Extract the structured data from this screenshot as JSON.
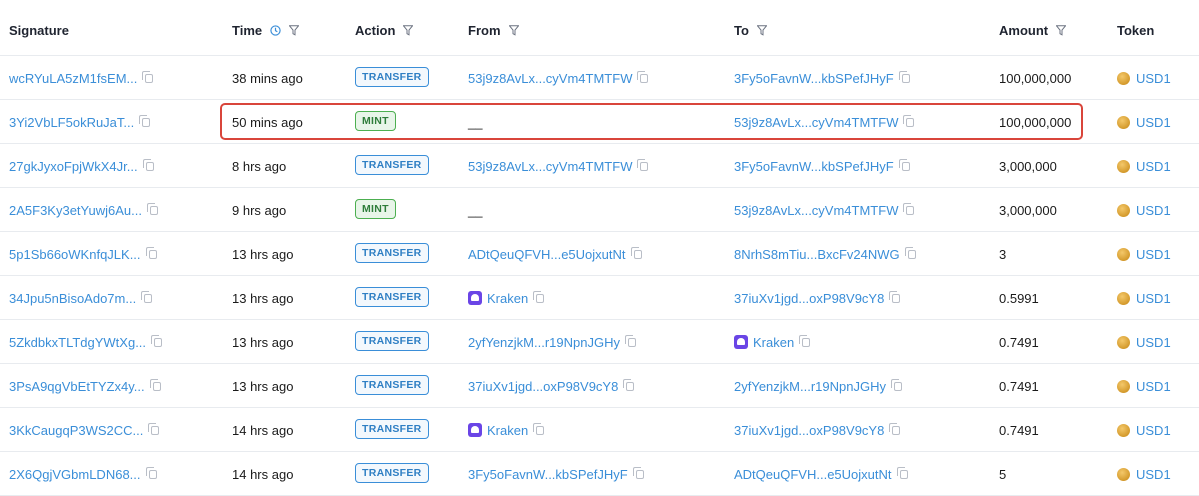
{
  "columns": {
    "signature": "Signature",
    "time": "Time",
    "action": "Action",
    "from": "From",
    "to": "To",
    "amount": "Amount",
    "token": "Token"
  },
  "rows": [
    {
      "signature": "wcRYuLA5zM1fsEM...",
      "time": "38 mins ago",
      "action": "TRANSFER",
      "from": "53j9z8AvLx...cyVm4TMTFW",
      "to": "3Fy5oFavnW...kbSPefJHyF",
      "amount": "100,000,000",
      "token": "USD1"
    },
    {
      "signature": "3Yi2VbLF5okRuJaT...",
      "time": "50 mins ago",
      "action": "MINT",
      "from": "__",
      "to": "53j9z8AvLx...cyVm4TMTFW",
      "amount": "100,000,000",
      "token": "USD1"
    },
    {
      "signature": "27gkJyxoFpjWkX4Jr...",
      "time": "8 hrs ago",
      "action": "TRANSFER",
      "from": "53j9z8AvLx...cyVm4TMTFW",
      "to": "3Fy5oFavnW...kbSPefJHyF",
      "amount": "3,000,000",
      "token": "USD1"
    },
    {
      "signature": "2A5F3Ky3etYuwj6Au...",
      "time": "9 hrs ago",
      "action": "MINT",
      "from": "__",
      "to": "53j9z8AvLx...cyVm4TMTFW",
      "amount": "3,000,000",
      "token": "USD1"
    },
    {
      "signature": "5p1Sb66oWKnfqJLK...",
      "time": "13 hrs ago",
      "action": "TRANSFER",
      "from": "ADtQeuQFVH...e5UojxutNt",
      "to": "8NrhS8mTiu...BxcFv24NWG",
      "amount": "3",
      "token": "USD1"
    },
    {
      "signature": "34Jpu5nBisoAdo7m...",
      "time": "13 hrs ago",
      "action": "TRANSFER",
      "from": "Kraken",
      "to": "37iuXv1jgd...oxP98V9cY8",
      "amount": "0.5991",
      "token": "USD1"
    },
    {
      "signature": "5ZkdbkxTLTdgYWtXg...",
      "time": "13 hrs ago",
      "action": "TRANSFER",
      "from": "2yfYenzjkM...r19NpnJGHy",
      "to": "Kraken",
      "amount": "0.7491",
      "token": "USD1"
    },
    {
      "signature": "3PsA9qgVbEtTYZx4y...",
      "time": "13 hrs ago",
      "action": "TRANSFER",
      "from": "37iuXv1jgd...oxP98V9cY8",
      "to": "2yfYenzjkM...r19NpnJGHy",
      "amount": "0.7491",
      "token": "USD1"
    },
    {
      "signature": "3KkCaugqP3WS2CC...",
      "time": "14 hrs ago",
      "action": "TRANSFER",
      "from": "Kraken",
      "to": "37iuXv1jgd...oxP98V9cY8",
      "amount": "0.7491",
      "token": "USD1"
    },
    {
      "signature": "2X6QgjVGbmLDN68...",
      "time": "14 hrs ago",
      "action": "TRANSFER",
      "from": "3Fy5oFavnW...kbSPefJHyF",
      "to": "ADtQeuQFVH...e5UojxutNt",
      "amount": "5",
      "token": "USD1"
    }
  ],
  "kraken_rows": {
    "from": [
      5,
      8
    ],
    "to": [
      6
    ]
  },
  "highlighted_row": 1,
  "colors": {
    "link": "#3a8ed8",
    "transfer": "#3a8ed8",
    "mint": "#4caf50",
    "highlight": "#d9453b",
    "kraken": "#6a45e6"
  }
}
